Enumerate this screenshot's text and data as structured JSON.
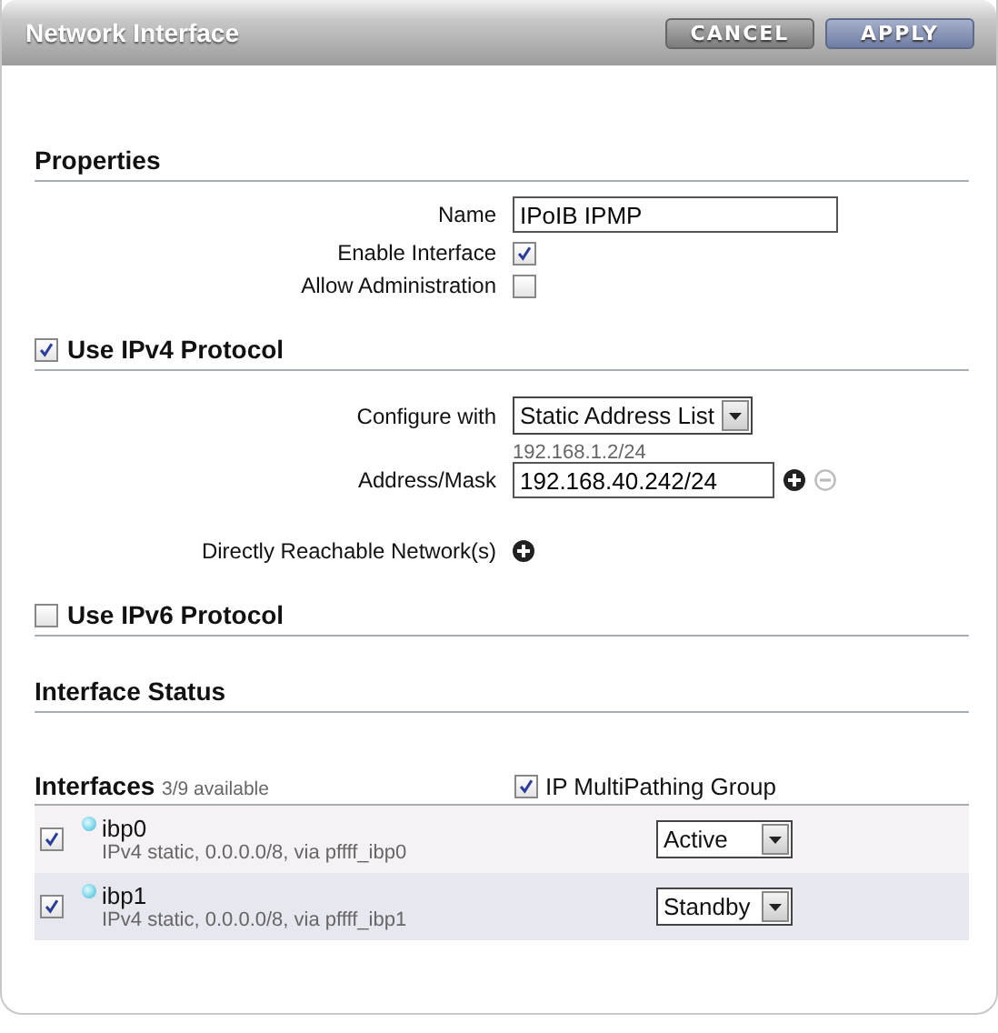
{
  "window": {
    "title": "Network Interface"
  },
  "buttons": [
    {
      "label": "CANCEL",
      "kind": "secondary"
    },
    {
      "label": "APPLY",
      "kind": "primary"
    }
  ],
  "properties": {
    "heading": "Properties",
    "name": {
      "label": "Name",
      "value": "IPoIB IPMP"
    },
    "enable_interface": {
      "label": "Enable Interface",
      "checked": true
    },
    "allow_administration": {
      "label": "Allow Administration",
      "checked": false
    }
  },
  "ipv4": {
    "label": "Use IPv4 Protocol",
    "checked": true,
    "configure_with": {
      "label": "Configure with",
      "value": "Static Address List"
    },
    "address_mask": {
      "label": "Address/Mask",
      "hint": "192.168.1.2/24",
      "value": "192.168.40.242/24"
    },
    "reachable": {
      "label": "Directly Reachable Network(s)"
    }
  },
  "ipv6": {
    "label": "Use IPv6 Protocol",
    "checked": false
  },
  "interface_status": {
    "heading": "Interface Status"
  },
  "interfaces": {
    "heading": "Interfaces",
    "count": "3/9 available",
    "ipmp": {
      "label": "IP MultiPathing Group",
      "checked": true
    },
    "rows": [
      {
        "name": "ibp0",
        "detail": "IPv4 static, 0.0.0.0/8, via pffff_ibp0",
        "checked": true,
        "mode": "Active"
      },
      {
        "name": "ibp1",
        "detail": "IPv4 static, 0.0.0.0/8, via pffff_ibp1",
        "checked": true,
        "mode": "Standby"
      }
    ]
  }
}
